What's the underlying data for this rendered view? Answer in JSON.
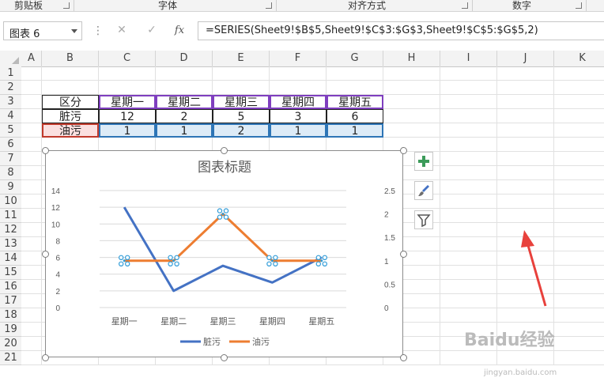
{
  "ribbon": {
    "groups": [
      "剪贴板",
      "字体",
      "对齐方式",
      "数字"
    ]
  },
  "formula_bar": {
    "name_box": "图表 6",
    "cancel_icon": "close-icon",
    "enter_icon": "check-icon",
    "fx_label": "fx",
    "formula": "=SERIES(Sheet9!$B$5,Sheet9!$C$3:$G$3,Sheet9!$C$5:$G$5,2)"
  },
  "columns": [
    "A",
    "B",
    "C",
    "D",
    "E",
    "F",
    "G",
    "H",
    "I",
    "J",
    "K"
  ],
  "rows": [
    "1",
    "2",
    "3",
    "4",
    "5",
    "6",
    "7",
    "8",
    "9",
    "10",
    "11",
    "12",
    "13",
    "14",
    "15",
    "16",
    "17",
    "18",
    "19",
    "20",
    "21"
  ],
  "table": {
    "header": [
      "区分",
      "星期一",
      "星期二",
      "星期三",
      "星期四",
      "星期五"
    ],
    "rows": [
      [
        "脏污",
        "12",
        "2",
        "5",
        "3",
        "6"
      ],
      [
        "油污",
        "1",
        "1",
        "2",
        "1",
        "1"
      ]
    ]
  },
  "chart_buttons": {
    "add": "plus-icon",
    "style": "brush-icon",
    "filter": "filter-icon"
  },
  "chart_data": {
    "type": "line",
    "title": "图表标题",
    "categories": [
      "星期一",
      "星期二",
      "星期三",
      "星期四",
      "星期五"
    ],
    "series": [
      {
        "name": "脏污",
        "values": [
          12,
          2,
          5,
          3,
          6
        ],
        "color": "#4472c4",
        "axis": "left"
      },
      {
        "name": "油污",
        "values": [
          1,
          1,
          2,
          1,
          1
        ],
        "color": "#ed7d31",
        "axis": "right"
      }
    ],
    "y_left": {
      "ticks": [
        "0",
        "2",
        "4",
        "6",
        "8",
        "10",
        "12",
        "14"
      ],
      "ylim": [
        0,
        14
      ]
    },
    "y_right": {
      "ticks": [
        "0",
        "0.5",
        "1",
        "1.5",
        "2",
        "2.5"
      ],
      "ylim": [
        0,
        2.5
      ]
    },
    "grid": true,
    "legend": "bottom"
  },
  "watermark": {
    "main": "Baidu经验",
    "sub": "jingyan.baidu.com"
  },
  "colors": {
    "accent_arrow": "#e8413c",
    "selection_purple": "#7f3fbf",
    "selection_blue": "#2e75b6",
    "selection_red": "#c0392b"
  }
}
